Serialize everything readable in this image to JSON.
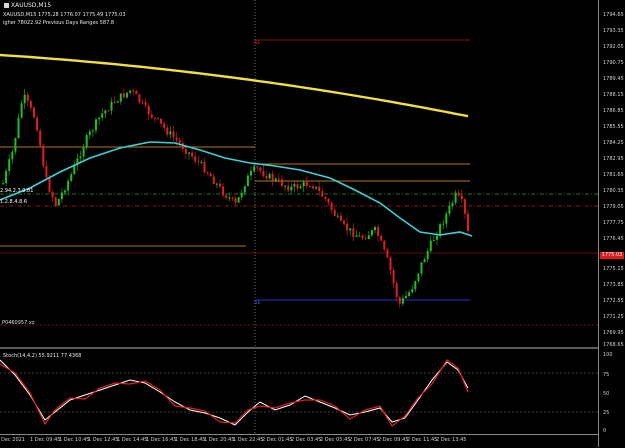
{
  "window": {
    "title": "XAUUSD,M15",
    "ohlc_line": "XAUUSD,M15  1775.28  1776.07  1775.49  1775.03",
    "info_line": "igher 78022.92  Previous Days Ranges 587.8",
    "left_labels": [
      "2.94.2.3.9.81",
      "1.2.8.4.8.6"
    ],
    "bottom_label": "P0460957 xz",
    "marker_top": "S1",
    "marker_bottom": "S1",
    "current_price": "1775.03"
  },
  "price_axis": {
    "labels": [
      "1794.65",
      "1793.35",
      "1792.05",
      "1790.75",
      "1789.45",
      "1788.15",
      "1786.85",
      "1785.55",
      "1784.25",
      "1782.95",
      "1781.65",
      "1780.35",
      "1779.05",
      "1777.75",
      "1776.45",
      "1775.15",
      "1773.85",
      "1772.55",
      "1771.25",
      "1769.95",
      "1768.65"
    ]
  },
  "indicator_axis": {
    "labels": [
      "100",
      "75",
      "50",
      "25",
      "0"
    ]
  },
  "indicator": {
    "label": "Stoch(14,4,2) 55.9211 77.4368"
  },
  "time_axis": {
    "labels": [
      "Dec 2021",
      "1 Dec 09:45",
      "1 Dec 10:45",
      "1 Dec 12:45",
      "1 Dec 14:45",
      "1 Dec 16:45",
      "1 Dec 18:45",
      "1 Dec 20:45",
      "1 Dec 22:45",
      "2 Dec 01:45",
      "2 Dec 03:45",
      "2 Dec 05:45",
      "2 Dec 07:45",
      "2 Dec 09:45",
      "2 Dec 11:45",
      "2 Dec 13:45"
    ]
  },
  "colors": {
    "bull": "#1fbf1f",
    "bear": "#e02020",
    "ma_slow": "#f0e040",
    "ma_fast": "#40d0d8",
    "level_orange": "#f0a020",
    "stoch_main": "#ffffff",
    "stoch_signal": "#e02020"
  }
}
